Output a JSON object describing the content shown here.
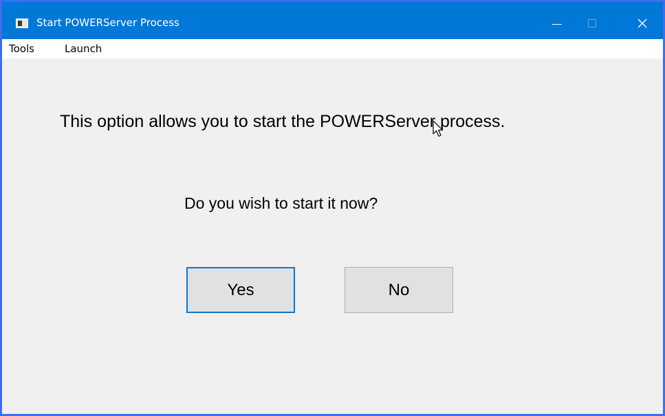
{
  "window": {
    "title": "Start POWERServer Process",
    "accent_color": "#0078d7",
    "frame_color": "#3c6ff0",
    "background_color": "#f0f0f0"
  },
  "titlebar": {
    "icons": {
      "app": "app-icon",
      "minimize": "minimize-icon",
      "maximize": "maximize-icon",
      "close": "close-icon"
    },
    "close_glyph": "✕"
  },
  "menu": {
    "items": [
      {
        "label": "Tools"
      },
      {
        "label": "Launch"
      }
    ]
  },
  "dialog": {
    "message": "This option allows you to start the POWERServer process.",
    "question": "Do you wish to start it now?",
    "buttons": {
      "yes": "Yes",
      "no": "No"
    }
  }
}
